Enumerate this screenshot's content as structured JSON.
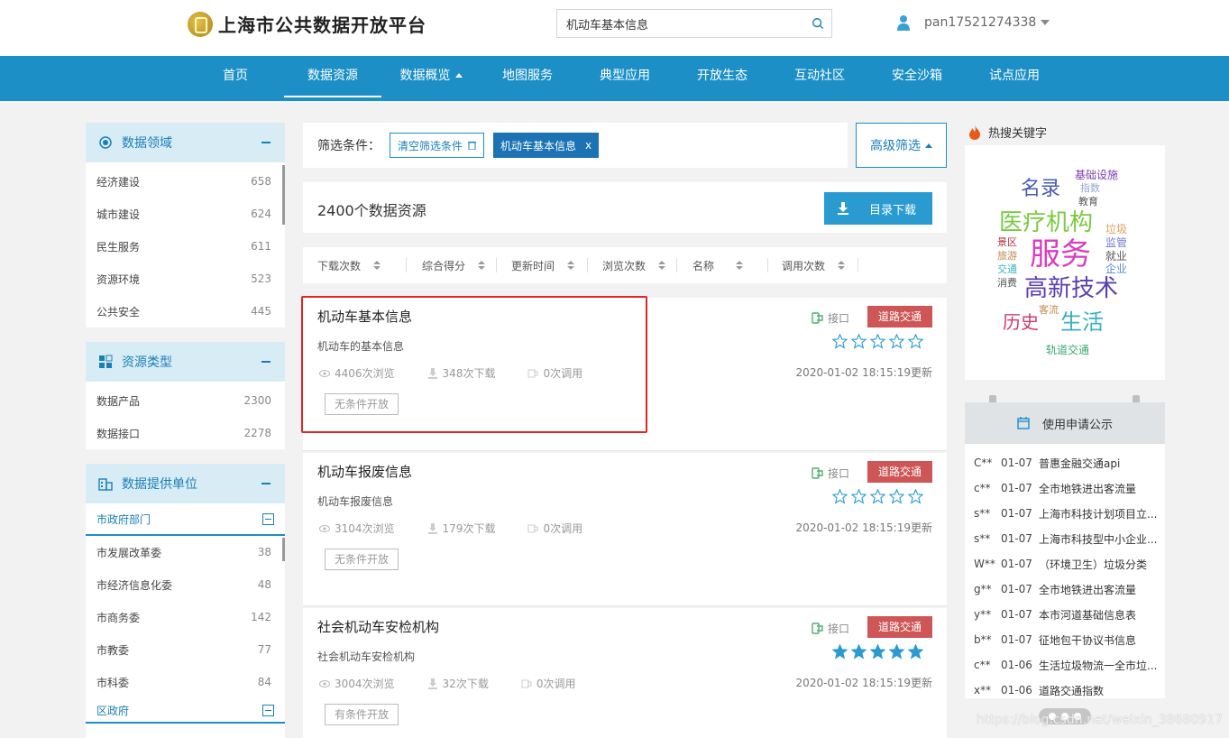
{
  "header": {
    "site_title": "上海市公共数据开放平台",
    "search_value": "机动车基本信息",
    "username": "pan17521274338"
  },
  "nav": {
    "items": [
      "首页",
      "数据资源",
      "数据概览",
      "地图服务",
      "典型应用",
      "开放生态",
      "互动社区",
      "安全沙箱",
      "试点应用"
    ],
    "active": "数据资源"
  },
  "sidebar": {
    "domain": {
      "title": "数据领域",
      "items": [
        {
          "label": "经济建设",
          "count": "658"
        },
        {
          "label": "城市建设",
          "count": "624"
        },
        {
          "label": "民生服务",
          "count": "611"
        },
        {
          "label": "资源环境",
          "count": "523"
        },
        {
          "label": "公共安全",
          "count": "445"
        }
      ]
    },
    "type": {
      "title": "资源类型",
      "items": [
        {
          "label": "数据产品",
          "count": "2300"
        },
        {
          "label": "数据接口",
          "count": "2278"
        }
      ]
    },
    "provider": {
      "title": "数据提供单位",
      "group1": "市政府部门",
      "items": [
        {
          "label": "市发展改革委",
          "count": "38"
        },
        {
          "label": "市经济信息化委",
          "count": "48"
        },
        {
          "label": "市商务委",
          "count": "142"
        },
        {
          "label": "市教委",
          "count": "77"
        },
        {
          "label": "市科委",
          "count": "84"
        }
      ],
      "group2": "区政府"
    }
  },
  "filter": {
    "label": "筛选条件：",
    "clear": "清空筛选条件",
    "chip": "机动车基本信息",
    "chip_close": "x",
    "advanced": "高级筛选"
  },
  "results": {
    "count_text": "2400个数据资源",
    "download_btn": "目录下载"
  },
  "sort": {
    "items": [
      "下载次数",
      "综合得分",
      "更新时间",
      "浏览次数",
      "名称",
      "调用次数"
    ]
  },
  "cards": [
    {
      "title": "机动车基本信息",
      "desc": "机动车的基本信息",
      "views": "4406次浏览",
      "downloads": "348次下载",
      "calls": "0次调用",
      "open": "无条件开放",
      "iface": "接口",
      "tag": "道路交通",
      "stars_filled": 0,
      "time": "2020-01-02 18:15:19更新"
    },
    {
      "title": "机动车报废信息",
      "desc": "机动车报废信息",
      "views": "3104次浏览",
      "downloads": "179次下载",
      "calls": "0次调用",
      "open": "无条件开放",
      "iface": "接口",
      "tag": "道路交通",
      "stars_filled": 0,
      "time": "2020-01-02 18:15:19更新"
    },
    {
      "title": "社会机动车安检机构",
      "desc": "社会机动车安检机构",
      "views": "3004次浏览",
      "downloads": "32次下载",
      "calls": "0次调用",
      "open": "有条件开放",
      "iface": "接口",
      "tag": "道路交通",
      "stars_filled": 5,
      "time": "2020-01-02 18:15:19更新"
    }
  ],
  "hot": {
    "title": "热搜关键字",
    "words": [
      "基础设施",
      "名录",
      "指数",
      "教育",
      "医疗机构",
      "垃圾",
      "景区",
      "服务",
      "监管",
      "旅游",
      "就业",
      "交通",
      "企业",
      "消费",
      "高新技术",
      "客流",
      "历史",
      "生活",
      "轨道交通"
    ]
  },
  "apply": {
    "title": "使用申请公示",
    "rows": [
      {
        "user": "C**",
        "date": "01-07",
        "text": "普惠金融交通api"
      },
      {
        "user": "c**",
        "date": "01-07",
        "text": "全市地铁进出客流量"
      },
      {
        "user": "s**",
        "date": "01-07",
        "text": "上海市科技计划项目立..."
      },
      {
        "user": "s**",
        "date": "01-07",
        "text": "上海市科技型中小企业..."
      },
      {
        "user": "W**",
        "date": "01-07",
        "text": "（环境卫生）垃圾分类"
      },
      {
        "user": "g**",
        "date": "01-07",
        "text": "全市地铁进出客流量"
      },
      {
        "user": "y**",
        "date": "01-07",
        "text": "本市河道基础信息表"
      },
      {
        "user": "b**",
        "date": "01-07",
        "text": "征地包干协议书信息"
      },
      {
        "user": "c**",
        "date": "01-06",
        "text": "生活垃圾物流一全市垃..."
      },
      {
        "user": "x**",
        "date": "01-06",
        "text": "道路交通指数"
      }
    ]
  },
  "watermark": "https://blog.csdn.net/weixin_38680917",
  "colors": {
    "brand_blue": "#1b8fc6",
    "tag_red": "#cf5656",
    "highlight_red": "#e02626",
    "star_blue": "#2a9bd0"
  }
}
